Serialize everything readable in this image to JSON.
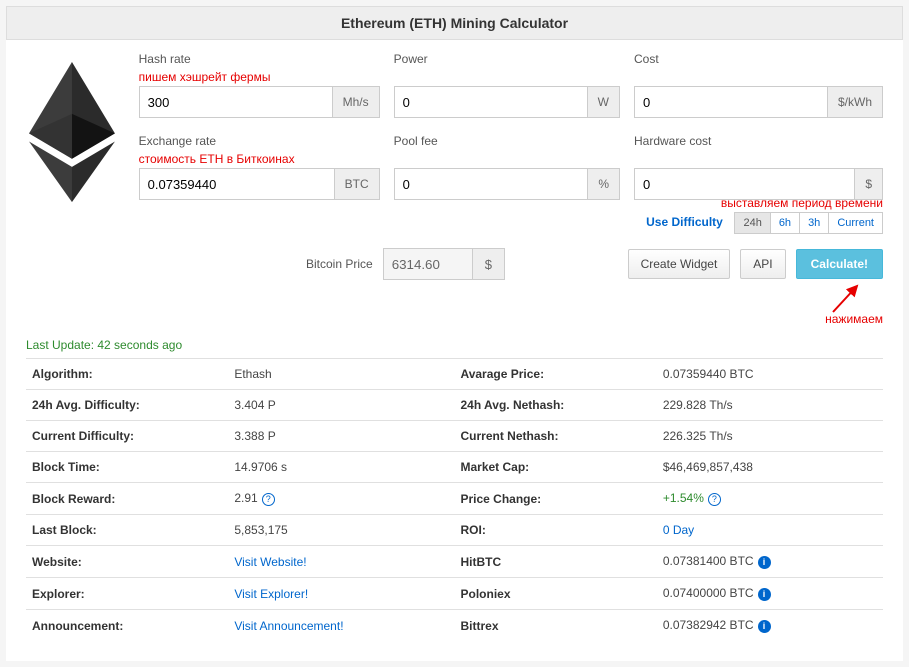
{
  "title": "Ethereum (ETH) Mining Calculator",
  "annotations": {
    "hashrate": "пишем хэшрейт фермы",
    "exchange": "стоимость ETH в Биткоинах",
    "period": "выставляем период времени",
    "click": "нажимаем"
  },
  "inputs": {
    "hashrate": {
      "label": "Hash rate",
      "value": "300",
      "unit": "Mh/s"
    },
    "power": {
      "label": "Power",
      "value": "0",
      "unit": "W"
    },
    "cost": {
      "label": "Cost",
      "value": "0",
      "unit": "$/kWh"
    },
    "exchange": {
      "label": "Exchange rate",
      "value": "0.07359440",
      "unit": "BTC"
    },
    "poolfee": {
      "label": "Pool fee",
      "value": "0",
      "unit": "%"
    },
    "hardware": {
      "label": "Hardware cost",
      "value": "0",
      "unit": "$"
    }
  },
  "difficulty": {
    "label": "Use Difficulty",
    "options": [
      "24h",
      "6h",
      "3h",
      "Current"
    ],
    "active": "24h"
  },
  "btc_price": {
    "label": "Bitcoin Price",
    "value": "6314.60",
    "unit": "$"
  },
  "buttons": {
    "widget": "Create Widget",
    "api": "API",
    "calc": "Calculate!"
  },
  "last_update": "Last Update: 42 seconds ago",
  "stats_left": [
    {
      "label": "Algorithm:",
      "value": "Ethash"
    },
    {
      "label": "24h Avg. Difficulty:",
      "value": "3.404 P"
    },
    {
      "label": "Current Difficulty:",
      "value": "3.388 P"
    },
    {
      "label": "Block Time:",
      "value": "14.9706 s"
    },
    {
      "label": "Block Reward:",
      "value": "2.91",
      "help": true
    },
    {
      "label": "Last Block:",
      "value": "5,853,175"
    },
    {
      "label": "Website:",
      "value": "Visit Website!",
      "link": true
    },
    {
      "label": "Explorer:",
      "value": "Visit Explorer!",
      "link": true
    },
    {
      "label": "Announcement:",
      "value": "Visit Announcement!",
      "link": true
    }
  ],
  "stats_right": [
    {
      "label": "Avarage Price:",
      "value": "0.07359440 BTC"
    },
    {
      "label": "24h Avg. Nethash:",
      "value": "229.828 Th/s"
    },
    {
      "label": "Current Nethash:",
      "value": "226.325 Th/s"
    },
    {
      "label": "Market Cap:",
      "value": "$46,469,857,438"
    },
    {
      "label": "Price Change:",
      "value": "+1.54%",
      "green": true,
      "help": true
    },
    {
      "label": "ROI:",
      "value": "0 Day",
      "link": true
    },
    {
      "label": "HitBTC",
      "value": "0.07381400 BTC",
      "info": true
    },
    {
      "label": "Poloniex",
      "value": "0.07400000 BTC",
      "info": true
    },
    {
      "label": "Bittrex",
      "value": "0.07382942 BTC",
      "info": true
    }
  ]
}
